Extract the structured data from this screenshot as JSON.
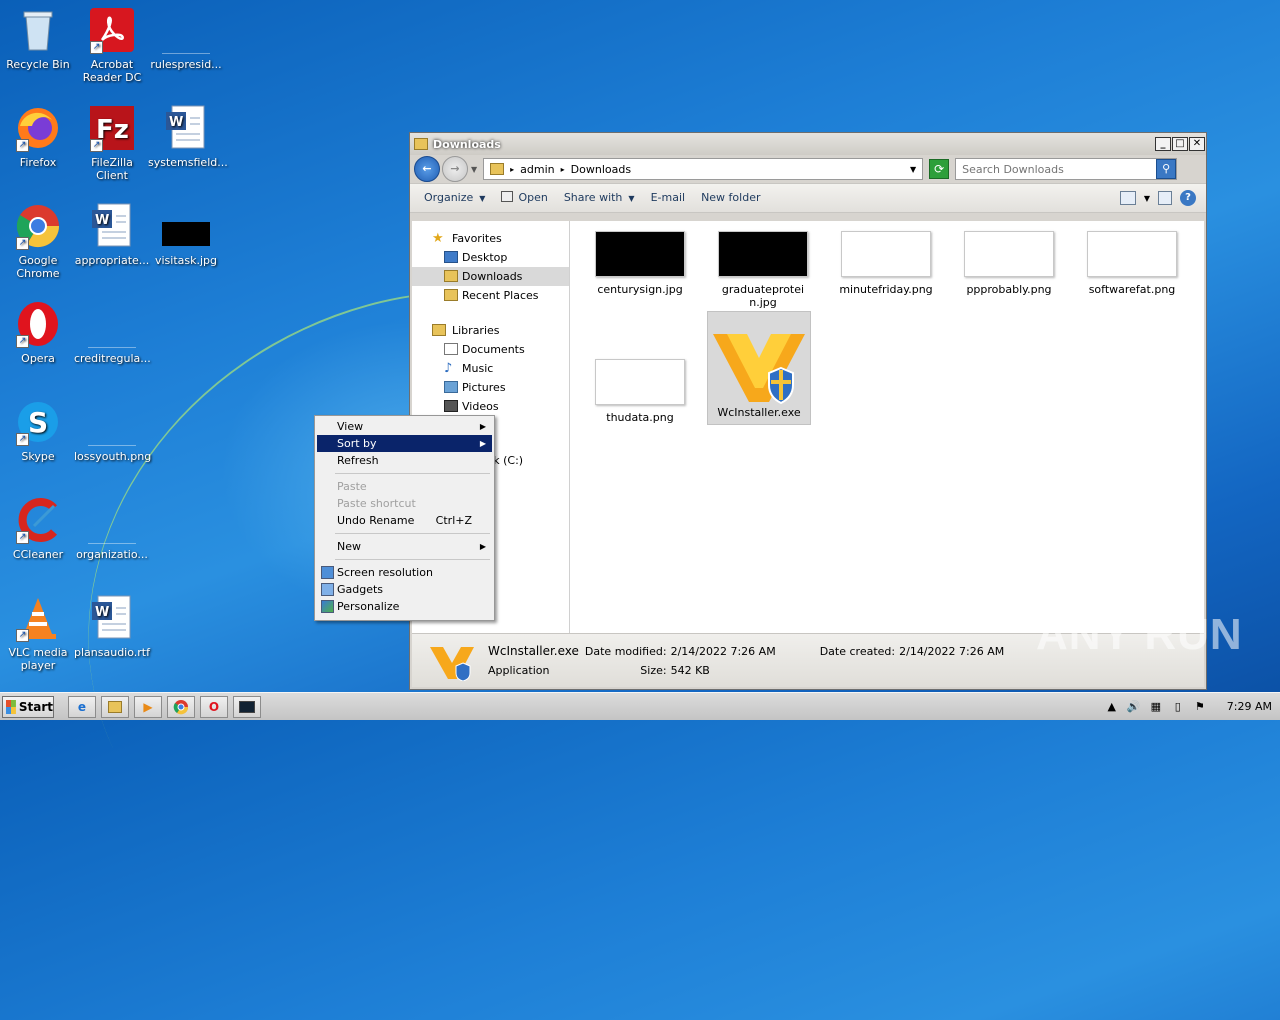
{
  "desktop": {
    "icons": [
      {
        "label": "Recycle Bin"
      },
      {
        "label": "Acrobat Reader DC"
      },
      {
        "label": "rulespresid..."
      },
      {
        "label": "Firefox"
      },
      {
        "label": "FileZilla Client"
      },
      {
        "label": "systemsfield..."
      },
      {
        "label": "Google Chrome"
      },
      {
        "label": "appropriate..."
      },
      {
        "label": "visitask.jpg"
      },
      {
        "label": "Opera"
      },
      {
        "label": "creditregula..."
      },
      {
        "label": "Skype"
      },
      {
        "label": "lossyouth.png"
      },
      {
        "label": "CCleaner"
      },
      {
        "label": "organizatio..."
      },
      {
        "label": "VLC media player"
      },
      {
        "label": "plansaudio.rtf"
      }
    ]
  },
  "window": {
    "title": "Downloads",
    "breadcrumb": [
      "admin",
      "Downloads"
    ],
    "search_placeholder": "Search Downloads",
    "toolbar": {
      "organize": "Organize",
      "open": "Open",
      "share_with": "Share with",
      "email": "E-mail",
      "new_folder": "New folder"
    },
    "nav": {
      "favorites": "Favorites",
      "desktop": "Desktop",
      "downloads": "Downloads",
      "recent_places": "Recent Places",
      "libraries": "Libraries",
      "documents": "Documents",
      "music": "Music",
      "pictures": "Pictures",
      "videos": "Videos",
      "computer_partial": "r",
      "local_disk_partial": "Disk (C:)"
    },
    "files": [
      {
        "name": "centurysign.jpg"
      },
      {
        "name": "graduateprotein.jpg"
      },
      {
        "name": "minutefriday.png"
      },
      {
        "name": "ppprobably.png"
      },
      {
        "name": "softwarefat.png"
      },
      {
        "name": "thudata.png"
      },
      {
        "name": "WcInstaller.exe"
      }
    ],
    "details": {
      "name": "WcInstaller.exe",
      "type": "Application",
      "date_modified_label": "Date modified:",
      "date_modified": "2/14/2022 7:26 AM",
      "size_label": "Size:",
      "size": "542 KB",
      "date_created_label": "Date created:",
      "date_created": "2/14/2022 7:26 AM"
    }
  },
  "context_menu": {
    "view": "View",
    "sort_by": "Sort by",
    "refresh": "Refresh",
    "paste": "Paste",
    "paste_shortcut": "Paste shortcut",
    "undo_rename": "Undo Rename",
    "undo_shortcut": "Ctrl+Z",
    "new": "New",
    "screen_resolution": "Screen resolution",
    "gadgets": "Gadgets",
    "personalize": "Personalize"
  },
  "taskbar": {
    "start": "Start",
    "clock": "7:29 AM"
  },
  "watermark": "ANY RUN"
}
